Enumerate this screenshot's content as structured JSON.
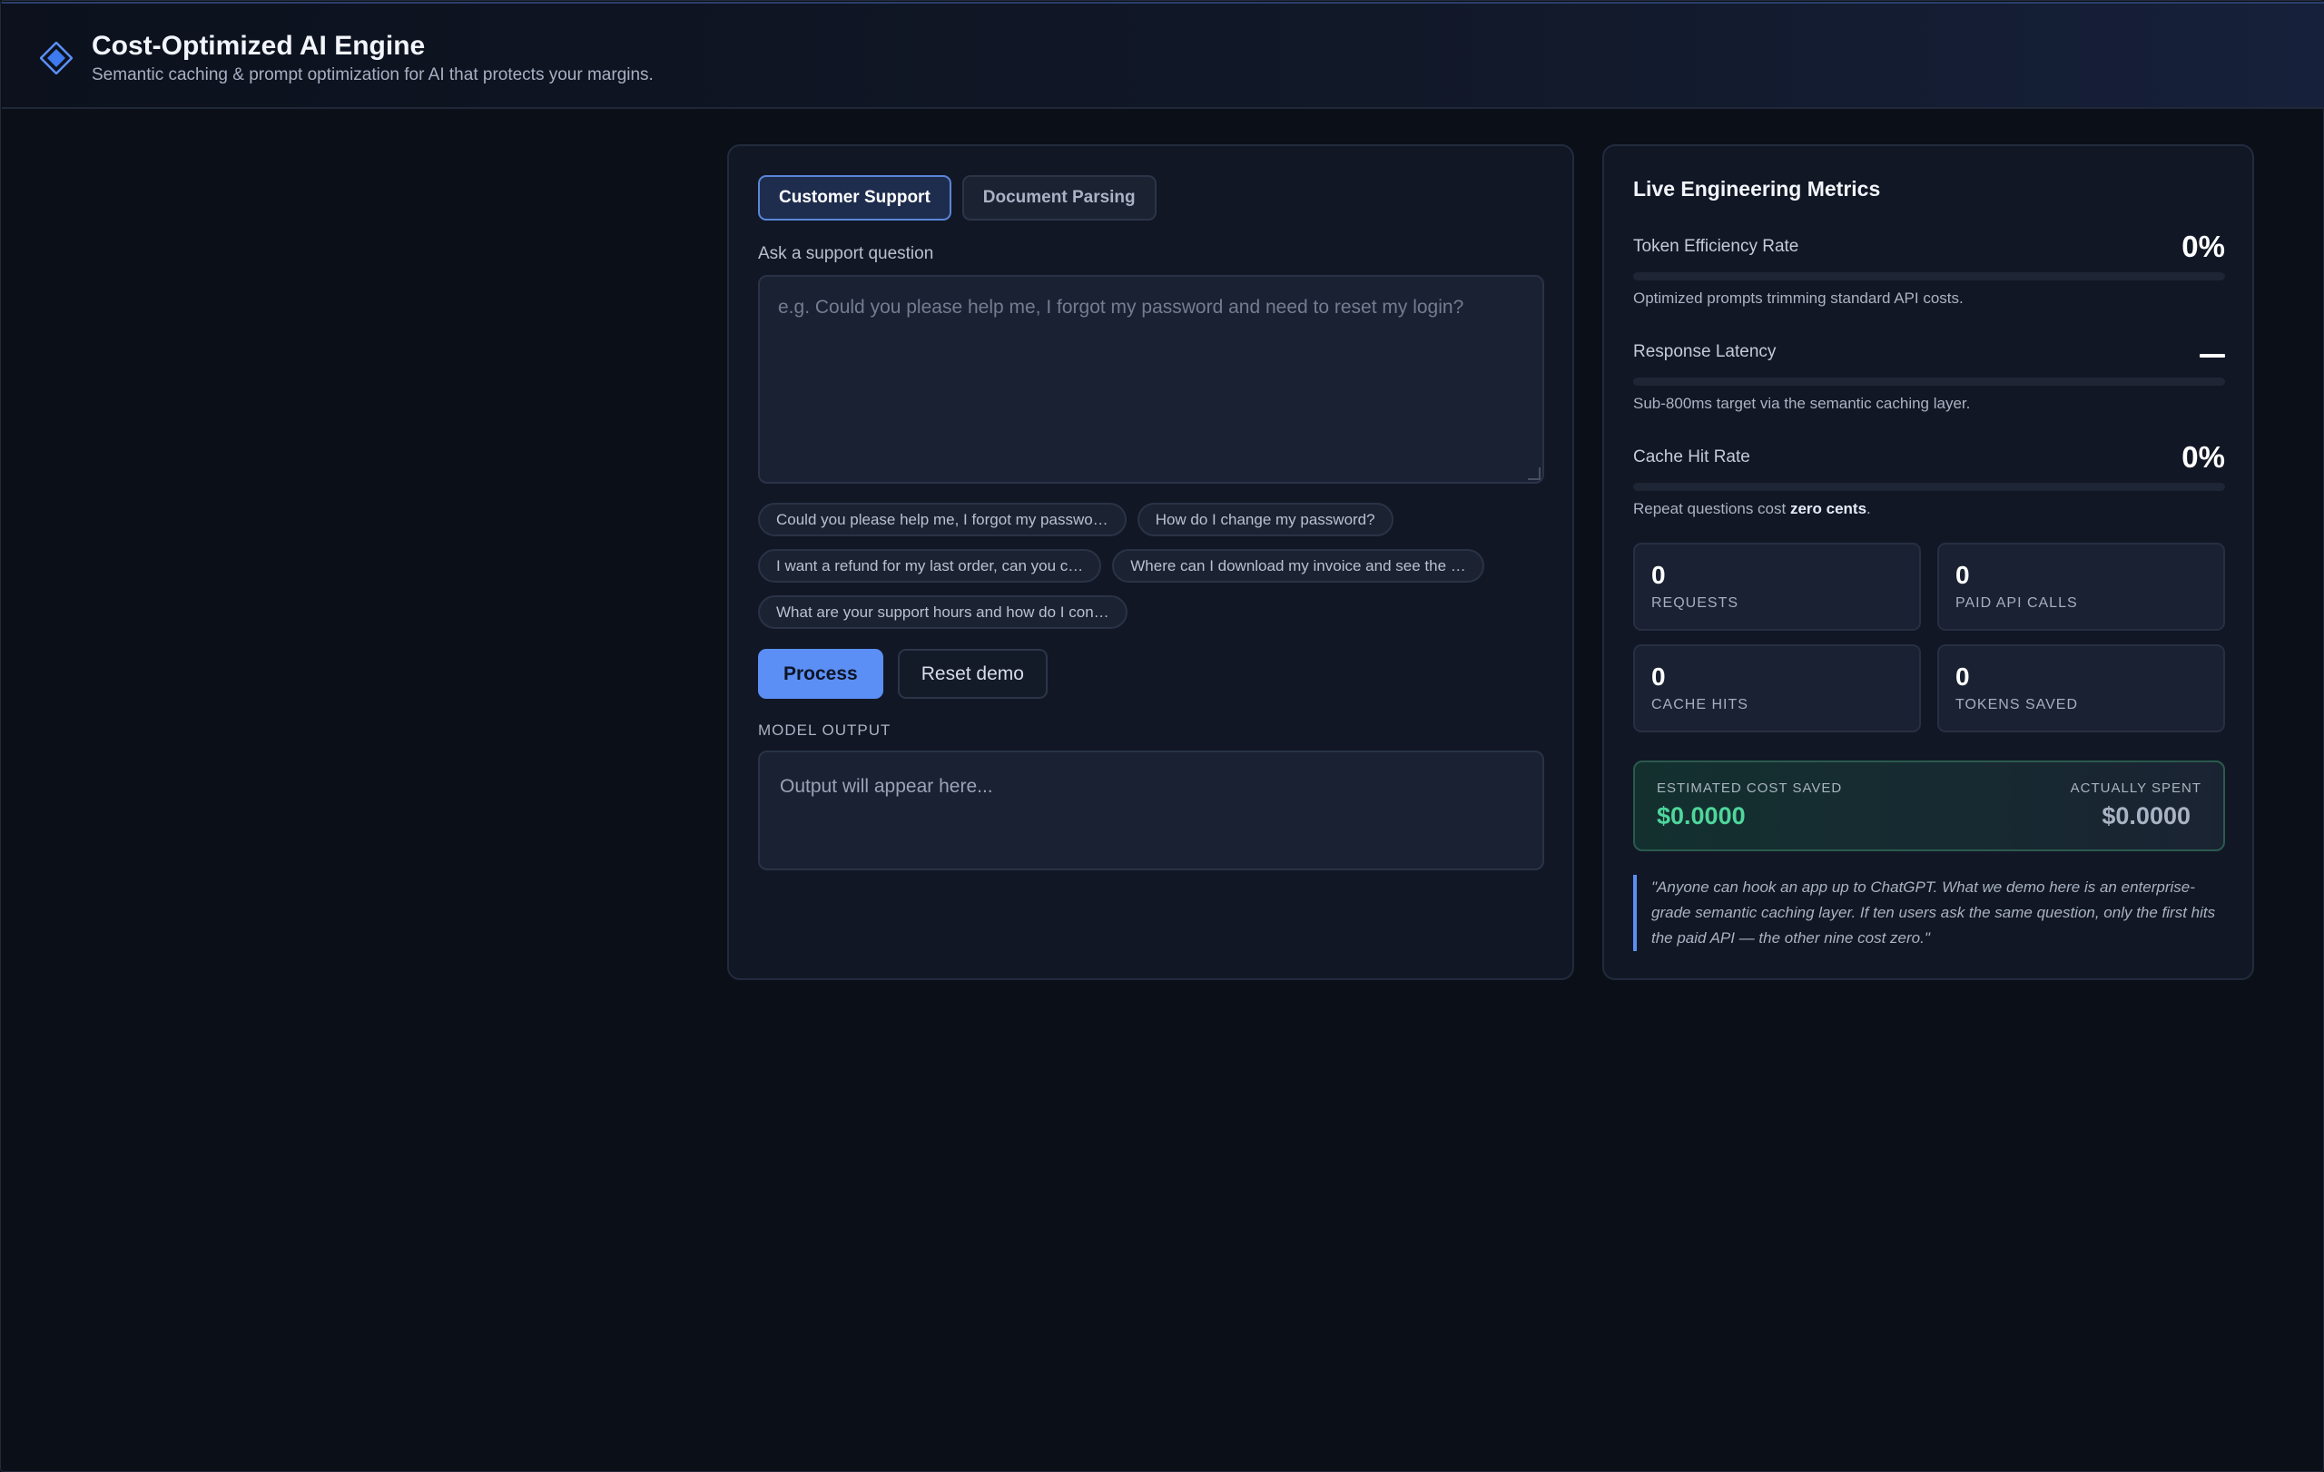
{
  "header": {
    "title": "Cost-Optimized AI Engine",
    "subtitle": "Semantic caching & prompt optimization for AI that protects your margins.",
    "logo_icon": "diamond-icon"
  },
  "main": {
    "tabs": [
      {
        "label": "Customer Support",
        "active": true
      },
      {
        "label": "Document Parsing",
        "active": false
      }
    ],
    "question_label": "Ask a support question",
    "question_placeholder": "e.g. Could you please help me, I forgot my password and need to reset my login?",
    "question_value": "",
    "suggestions": [
      "Could you please help me, I forgot my passwo…",
      "How do I change my password?",
      "I want a refund for my last order, can you c…",
      "Where can I download my invoice and see the …",
      "What are your support hours and how do I con…"
    ],
    "process_label": "Process",
    "reset_label": "Reset demo",
    "output_label": "MODEL OUTPUT",
    "output_placeholder": "Output will appear here..."
  },
  "metrics": {
    "title": "Live Engineering Metrics",
    "token_efficiency": {
      "label": "Token Efficiency Rate",
      "value": "0%",
      "progress": 0,
      "note": "Optimized prompts trimming standard API costs."
    },
    "latency": {
      "label": "Response Latency",
      "value": "—",
      "progress": 0,
      "note": "Sub-800ms target via the semantic caching layer."
    },
    "cache_hit": {
      "label": "Cache Hit Rate",
      "value": "0%",
      "progress": 0,
      "note_prefix": "Repeat questions cost ",
      "note_bold": "zero cents",
      "note_suffix": "."
    },
    "stats": [
      {
        "value": "0",
        "label": "REQUESTS"
      },
      {
        "value": "0",
        "label": "PAID API CALLS"
      },
      {
        "value": "0",
        "label": "CACHE HITS"
      },
      {
        "value": "0",
        "label": "TOKENS SAVED"
      }
    ],
    "cost": {
      "saved_label": "ESTIMATED COST SAVED",
      "saved_value": "$0.0000",
      "spent_label": "ACTUALLY SPENT",
      "spent_value": "$0.0000"
    },
    "quote": "\"Anyone can hook an app up to ChatGPT. What we demo here is an enterprise-grade semantic caching layer. If ten users ask the same question, only the first hits the paid API — the other nine cost zero.\""
  },
  "colors": {
    "accent": "#5b8ff5",
    "saved_green": "#4fd69c",
    "background": "#0b0f18",
    "panel": "#111725"
  }
}
